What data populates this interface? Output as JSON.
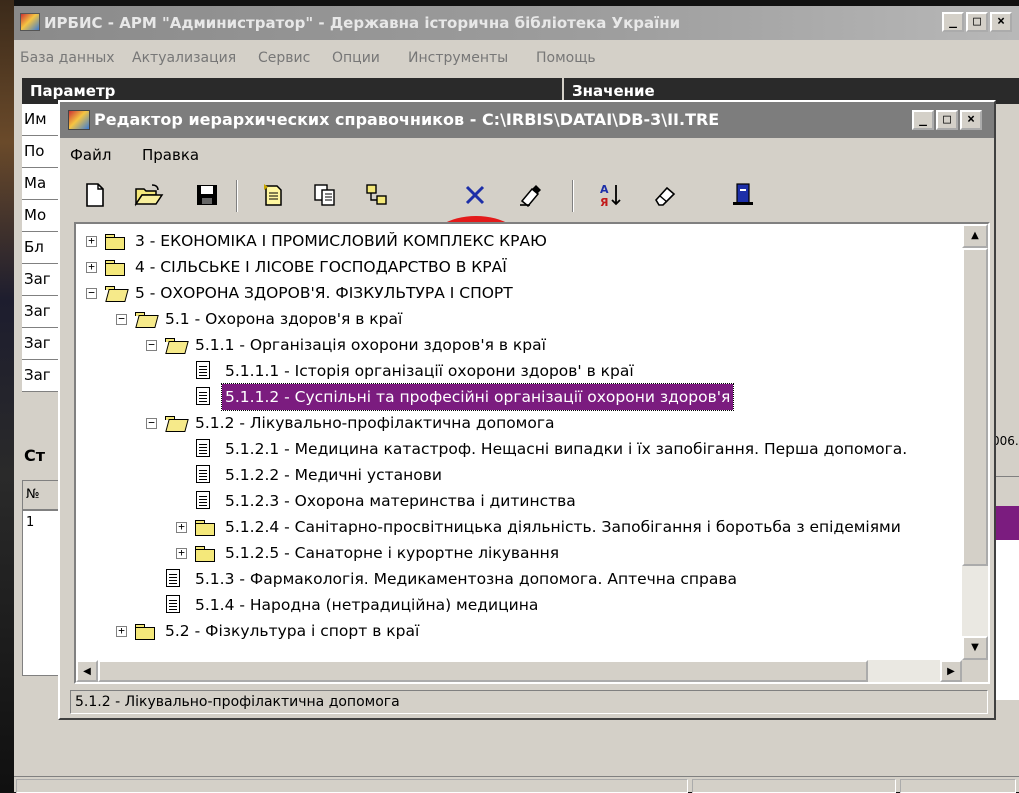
{
  "main_window": {
    "title": "ИРБИС - АРМ \"Администратор\" - Державна історична бібліотека України",
    "controls": [
      "_",
      "□",
      "×"
    ],
    "menu": [
      "База данных",
      "Актуализация",
      "Сервис",
      "Опции",
      "Инструменты",
      "Помощь"
    ],
    "grid_headers": [
      "Параметр",
      "Значение"
    ],
    "left_cells": [
      "Им",
      "По",
      "Ма",
      "Мо",
      "Бл",
      "Заг",
      "Заг",
      "Заг",
      "Заг"
    ],
    "lower_label": "Ст",
    "lower_col_header": "№",
    "lower_row": "1",
    "right_fragment": "006."
  },
  "dialog": {
    "title": "Редактор иерархических справочников - C:\\IRBIS\\DATAI\\DB-3\\II.TRE",
    "controls": [
      "_",
      "□",
      "×"
    ],
    "menu": [
      "Файл",
      "Правка"
    ],
    "toolbar": [
      {
        "name": "new-file-icon"
      },
      {
        "name": "open-folder-icon"
      },
      {
        "name": "save-disk-icon"
      },
      {
        "name": "add-item-icon"
      },
      {
        "name": "copy-icon"
      },
      {
        "name": "add-subitem-icon"
      },
      {
        "name": "delete-x-icon"
      },
      {
        "name": "edit-brush-icon"
      },
      {
        "name": "sort-az-icon"
      },
      {
        "name": "eraser-icon"
      },
      {
        "name": "exit-door-icon"
      }
    ],
    "tree": [
      {
        "text": "3 - ЕКОНОМІКА І ПРОМИСЛОВИЙ КОМПЛЕКС КРАЮ",
        "level": 0,
        "kind": "folder",
        "expander": "+"
      },
      {
        "text": "4 - СІЛЬСЬКЕ І ЛІСОВЕ ГОСПОДАРСТВО В КРАЇ",
        "level": 0,
        "kind": "folder",
        "expander": "+"
      },
      {
        "text": "5 - ОХОРОНА ЗДОРОВ'Я. ФІЗКУЛЬТУРА І СПОРТ",
        "level": 0,
        "kind": "folder-open",
        "expander": "−"
      },
      {
        "text": "5.1 - Охорона здоров'я в краї",
        "level": 1,
        "kind": "folder-open",
        "expander": "−"
      },
      {
        "text": "5.1.1 - Організація охорони здоров'я в краї",
        "level": 2,
        "kind": "folder-open",
        "expander": "−"
      },
      {
        "text": "5.1.1.1 - Історія організації охорони здоров' в краї",
        "level": 3,
        "kind": "doc",
        "expander": ""
      },
      {
        "text": "5.1.1.2 - Суспільні та професійні організації охорони здоров'я",
        "level": 3,
        "kind": "doc",
        "expander": "",
        "selected": true
      },
      {
        "text": "5.1.2 - Лікувально-профілактична допомога",
        "level": 2,
        "kind": "folder-open",
        "expander": "−"
      },
      {
        "text": "5.1.2.1 - Медицина катастроф. Нещасні випадки і їх запобігання. Перша допомога.",
        "level": 3,
        "kind": "doc",
        "expander": ""
      },
      {
        "text": "5.1.2.2 - Медичні установи",
        "level": 3,
        "kind": "doc",
        "expander": ""
      },
      {
        "text": "5.1.2.3 - Охорона материнства і дитинства",
        "level": 3,
        "kind": "doc",
        "expander": ""
      },
      {
        "text": "5.1.2.4 - Санітарно-просвітницька діяльність. Запобігання і боротьба з епідеміями",
        "level": 3,
        "kind": "folder",
        "expander": "+"
      },
      {
        "text": "5.1.2.5 - Санаторне і курортне лікування",
        "level": 3,
        "kind": "folder",
        "expander": "+"
      },
      {
        "text": "5.1.3 - Фармакологія. Медикаментозна допомога. Аптечна справа",
        "level": 2,
        "kind": "doc",
        "expander": ""
      },
      {
        "text": "5.1.4 - Народна (нетрадиційна) медицина",
        "level": 2,
        "kind": "doc",
        "expander": ""
      },
      {
        "text": "5.2 - Фізкультура і спорт в краї",
        "level": 1,
        "kind": "folder",
        "expander": "+"
      }
    ],
    "status": "5.1.2 - Лікувально-профілактична допомога"
  },
  "colors": {
    "selection": "#7b1c7f",
    "annotation_circle": "#e31b1b",
    "face": "#d4d0c8"
  }
}
